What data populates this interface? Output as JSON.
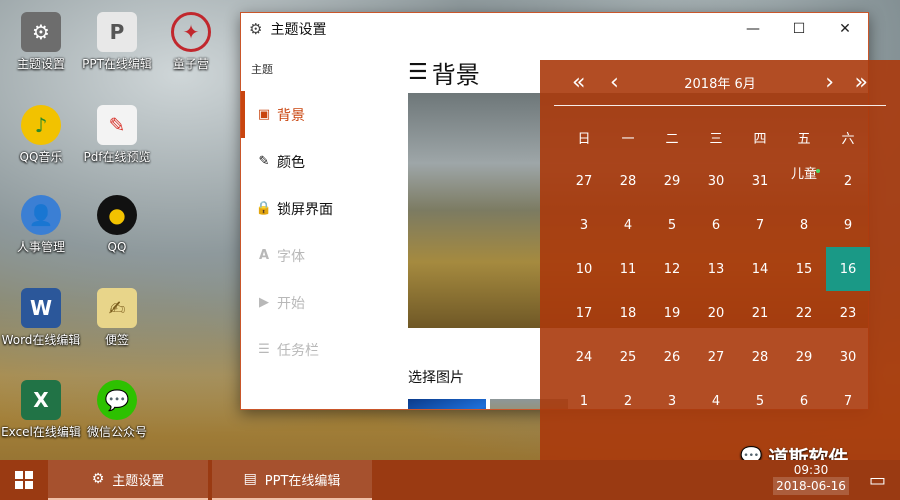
{
  "desktop": {
    "icons": [
      {
        "label": "主题设置",
        "icon": "gear-icon",
        "color": "#6d6d6d"
      },
      {
        "label": "PPT在线编辑",
        "icon": "ppt-icon",
        "color": "#e8e8e8"
      },
      {
        "label": "童子营",
        "icon": "logo-icon",
        "color": "#c1272d"
      },
      {
        "label": "QQ音乐",
        "icon": "music-icon",
        "color": "#f2c200"
      },
      {
        "label": "Pdf在线预览",
        "icon": "pdf-icon",
        "color": "#d9322a"
      },
      {
        "label": "人事管理",
        "icon": "person-icon",
        "color": "#3b7fd4"
      },
      {
        "label": "QQ",
        "icon": "penguin-icon",
        "color": "#111111"
      },
      {
        "label": "Word在线编辑",
        "icon": "word-icon",
        "color": "#2b579a"
      },
      {
        "label": "便签",
        "icon": "note-icon",
        "color": "#e8d58a"
      },
      {
        "label": "Excel在线编辑",
        "icon": "excel-icon",
        "color": "#217346"
      },
      {
        "label": "微信公众号",
        "icon": "wechat-icon",
        "color": "#2dc100"
      }
    ]
  },
  "window": {
    "title": "主题设置",
    "minimize": "—",
    "maximize": "☐",
    "close": "✕",
    "sidebar_header": "主题",
    "nav": [
      {
        "label": "背景",
        "icon": "image-icon",
        "state": "active"
      },
      {
        "label": "颜色",
        "icon": "brush-icon",
        "state": "normal"
      },
      {
        "label": "锁屏界面",
        "icon": "lock-icon",
        "state": "normal"
      },
      {
        "label": "字体",
        "icon": "font-icon",
        "state": "disabled"
      },
      {
        "label": "开始",
        "icon": "play-icon",
        "state": "disabled"
      },
      {
        "label": "任务栏",
        "icon": "list-icon",
        "state": "disabled"
      }
    ],
    "main_title": "背景",
    "choose_label": "选择图片"
  },
  "calendar": {
    "month_label": "2018年   6月",
    "prev_year": "«",
    "prev_month": "‹",
    "next_month": "›",
    "next_year": "»",
    "weekdays": [
      "日",
      "一",
      "二",
      "三",
      "四",
      "五",
      "六"
    ],
    "weeks": [
      [
        "27",
        "28",
        "29",
        "30",
        "31",
        "儿童",
        "2"
      ],
      [
        "3",
        "4",
        "5",
        "6",
        "7",
        "8",
        "9"
      ],
      [
        "10",
        "11",
        "12",
        "13",
        "14",
        "15",
        "16"
      ],
      [
        "17",
        "18",
        "19",
        "20",
        "21",
        "22",
        "23"
      ],
      [
        "24",
        "25",
        "26",
        "27",
        "28",
        "29",
        "30"
      ],
      [
        "1",
        "2",
        "3",
        "4",
        "5",
        "6",
        "7"
      ]
    ],
    "today": "16",
    "accent": "#1a9986"
  },
  "taskbar": {
    "apps": [
      {
        "label": "主题设置",
        "icon": "gear-icon"
      },
      {
        "label": "PPT在线编辑",
        "icon": "ppt-icon"
      }
    ],
    "time": "09:30",
    "date": "2018-06-16"
  },
  "watermark": "道斯软件"
}
